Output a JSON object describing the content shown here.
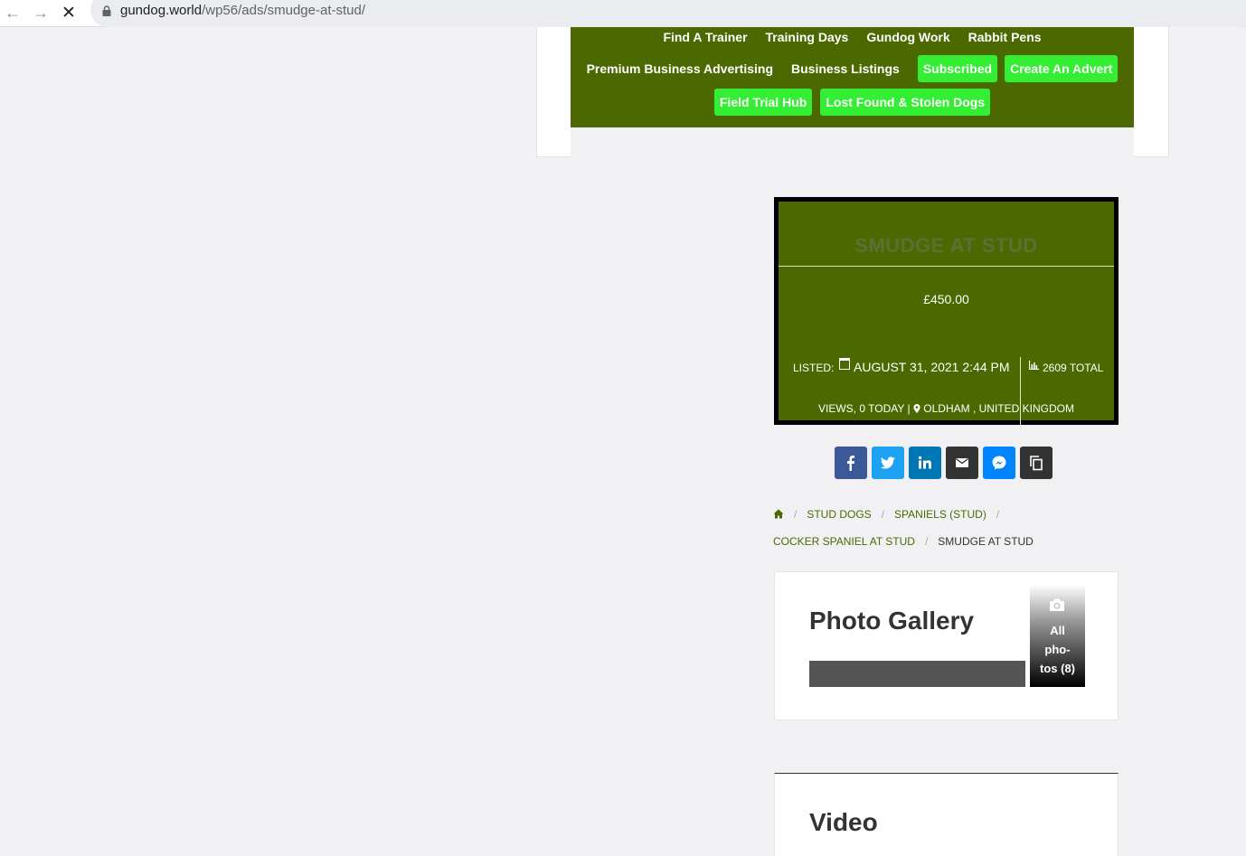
{
  "browser": {
    "url_host": "gundog.world",
    "url_path": "/wp56/ads/smudge-at-stud/",
    "back_glyph": "←",
    "forward_glyph": "→",
    "stop_glyph": "✕"
  },
  "nav": {
    "row1": [
      "Find A Trainer",
      "Training Days",
      "Gundog Work",
      "Rabbit Pens"
    ],
    "row2_links": [
      "Premium Business Advertising",
      "Business Listings"
    ],
    "row2_pills": [
      "Subscribed",
      "Create An Advert"
    ],
    "row3_pills": [
      "Field Trial Hub",
      "Lost Found & Stolen Dogs"
    ]
  },
  "ad": {
    "title": "SMUDGE AT STUD",
    "price": "£450.00",
    "listed_label": "LISTED:",
    "listed_date": "AUGUST 31, 2021 2:44 PM",
    "views_total": "2609 TOTAL",
    "views_line2": "VIEWS, 0 TODAY |",
    "location": "OLDHAM , UNITED KINGDOM"
  },
  "share": {
    "buttons": [
      {
        "name": "facebook",
        "color": "#3b5998",
        "glyph": "f"
      },
      {
        "name": "twitter",
        "color": "#1da1f2",
        "glyph": "t"
      },
      {
        "name": "linkedin",
        "color": "#0077b5",
        "glyph": "in"
      },
      {
        "name": "email",
        "color": "#333333",
        "glyph": "mail"
      },
      {
        "name": "messenger",
        "color": "#0084ff",
        "glyph": "m"
      },
      {
        "name": "copy",
        "color": "#333333",
        "glyph": "copy"
      }
    ]
  },
  "breadcrumb": {
    "home_icon": "home-icon",
    "items": [
      "STUD DOGS",
      "SPANIELS (STUD)",
      "COCKER SPANIEL AT STUD"
    ],
    "current": "SMUDGE AT STUD",
    "separator": "/"
  },
  "gallery": {
    "title": "Photo Gallery",
    "all_photos_line1": "All",
    "all_photos_line2": "pho-",
    "all_photos_line3": "tos (8)"
  },
  "video": {
    "title": "Video"
  },
  "colors": {
    "brand_green": "#4b6900",
    "pill_green": "#33ee33"
  }
}
